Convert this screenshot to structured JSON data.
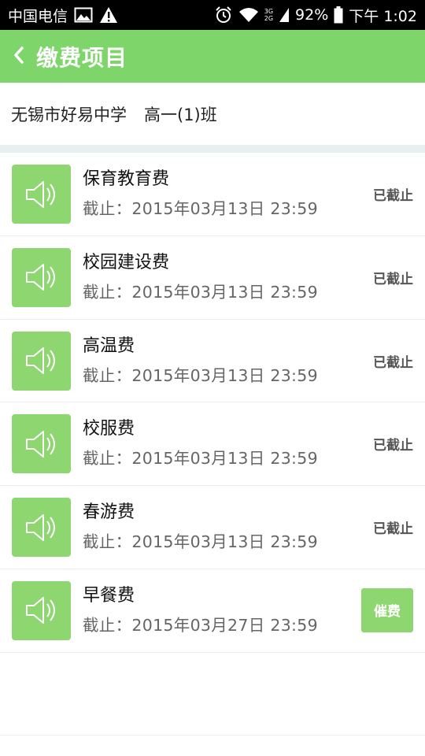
{
  "status_bar": {
    "carrier": "中国电信",
    "battery": "92%",
    "time": "下午 1:02",
    "net_top": "3G",
    "net_bottom": "2G",
    "icons": [
      "image-icon",
      "warning-icon",
      "alarm-icon",
      "wifi-icon",
      "signal-icon",
      "battery-icon"
    ]
  },
  "app_bar": {
    "title": "缴费项目",
    "back_icon": "chevron-left-icon"
  },
  "class_info": {
    "school": "无锡市好易中学",
    "class_name": "高一(1)班"
  },
  "items": [
    {
      "name": "保育教育费",
      "deadline": "截止：2015年03月13日  23:59",
      "status": "已截止",
      "icon": "speaker-icon"
    },
    {
      "name": "校园建设费",
      "deadline": "截止：2015年03月13日  23:59",
      "status": "已截止",
      "icon": "speaker-icon"
    },
    {
      "name": "高温费",
      "deadline": "截止：2015年03月13日  23:59",
      "status": "已截止",
      "icon": "speaker-icon"
    },
    {
      "name": "校服费",
      "deadline": "截止：2015年03月13日  23:59",
      "status": "已截止",
      "icon": "speaker-icon"
    },
    {
      "name": "春游费",
      "deadline": "截止：2015年03月13日  23:59",
      "status": "已截止",
      "icon": "speaker-icon"
    },
    {
      "name": "早餐费",
      "deadline": "截止：2015年03月27日  23:59",
      "action": "催费",
      "icon": "speaker-icon"
    }
  ],
  "colors": {
    "accent": "#7ed56a",
    "thumb": "#8ed66f",
    "separator": "#e7f0ef"
  }
}
